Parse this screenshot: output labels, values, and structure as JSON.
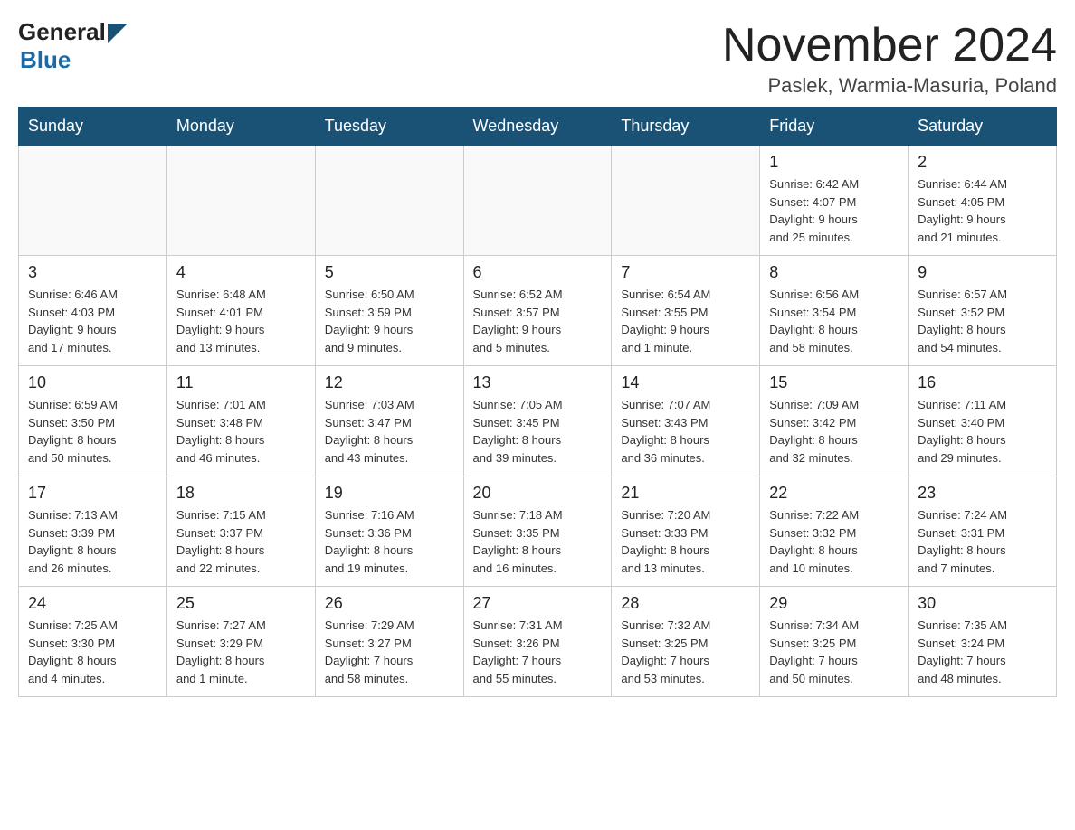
{
  "header": {
    "logo_general": "General",
    "logo_blue": "Blue",
    "month_title": "November 2024",
    "location": "Paslek, Warmia-Masuria, Poland"
  },
  "weekdays": [
    "Sunday",
    "Monday",
    "Tuesday",
    "Wednesday",
    "Thursday",
    "Friday",
    "Saturday"
  ],
  "weeks": [
    [
      {
        "day": "",
        "info": ""
      },
      {
        "day": "",
        "info": ""
      },
      {
        "day": "",
        "info": ""
      },
      {
        "day": "",
        "info": ""
      },
      {
        "day": "",
        "info": ""
      },
      {
        "day": "1",
        "info": "Sunrise: 6:42 AM\nSunset: 4:07 PM\nDaylight: 9 hours\nand 25 minutes."
      },
      {
        "day": "2",
        "info": "Sunrise: 6:44 AM\nSunset: 4:05 PM\nDaylight: 9 hours\nand 21 minutes."
      }
    ],
    [
      {
        "day": "3",
        "info": "Sunrise: 6:46 AM\nSunset: 4:03 PM\nDaylight: 9 hours\nand 17 minutes."
      },
      {
        "day": "4",
        "info": "Sunrise: 6:48 AM\nSunset: 4:01 PM\nDaylight: 9 hours\nand 13 minutes."
      },
      {
        "day": "5",
        "info": "Sunrise: 6:50 AM\nSunset: 3:59 PM\nDaylight: 9 hours\nand 9 minutes."
      },
      {
        "day": "6",
        "info": "Sunrise: 6:52 AM\nSunset: 3:57 PM\nDaylight: 9 hours\nand 5 minutes."
      },
      {
        "day": "7",
        "info": "Sunrise: 6:54 AM\nSunset: 3:55 PM\nDaylight: 9 hours\nand 1 minute."
      },
      {
        "day": "8",
        "info": "Sunrise: 6:56 AM\nSunset: 3:54 PM\nDaylight: 8 hours\nand 58 minutes."
      },
      {
        "day": "9",
        "info": "Sunrise: 6:57 AM\nSunset: 3:52 PM\nDaylight: 8 hours\nand 54 minutes."
      }
    ],
    [
      {
        "day": "10",
        "info": "Sunrise: 6:59 AM\nSunset: 3:50 PM\nDaylight: 8 hours\nand 50 minutes."
      },
      {
        "day": "11",
        "info": "Sunrise: 7:01 AM\nSunset: 3:48 PM\nDaylight: 8 hours\nand 46 minutes."
      },
      {
        "day": "12",
        "info": "Sunrise: 7:03 AM\nSunset: 3:47 PM\nDaylight: 8 hours\nand 43 minutes."
      },
      {
        "day": "13",
        "info": "Sunrise: 7:05 AM\nSunset: 3:45 PM\nDaylight: 8 hours\nand 39 minutes."
      },
      {
        "day": "14",
        "info": "Sunrise: 7:07 AM\nSunset: 3:43 PM\nDaylight: 8 hours\nand 36 minutes."
      },
      {
        "day": "15",
        "info": "Sunrise: 7:09 AM\nSunset: 3:42 PM\nDaylight: 8 hours\nand 32 minutes."
      },
      {
        "day": "16",
        "info": "Sunrise: 7:11 AM\nSunset: 3:40 PM\nDaylight: 8 hours\nand 29 minutes."
      }
    ],
    [
      {
        "day": "17",
        "info": "Sunrise: 7:13 AM\nSunset: 3:39 PM\nDaylight: 8 hours\nand 26 minutes."
      },
      {
        "day": "18",
        "info": "Sunrise: 7:15 AM\nSunset: 3:37 PM\nDaylight: 8 hours\nand 22 minutes."
      },
      {
        "day": "19",
        "info": "Sunrise: 7:16 AM\nSunset: 3:36 PM\nDaylight: 8 hours\nand 19 minutes."
      },
      {
        "day": "20",
        "info": "Sunrise: 7:18 AM\nSunset: 3:35 PM\nDaylight: 8 hours\nand 16 minutes."
      },
      {
        "day": "21",
        "info": "Sunrise: 7:20 AM\nSunset: 3:33 PM\nDaylight: 8 hours\nand 13 minutes."
      },
      {
        "day": "22",
        "info": "Sunrise: 7:22 AM\nSunset: 3:32 PM\nDaylight: 8 hours\nand 10 minutes."
      },
      {
        "day": "23",
        "info": "Sunrise: 7:24 AM\nSunset: 3:31 PM\nDaylight: 8 hours\nand 7 minutes."
      }
    ],
    [
      {
        "day": "24",
        "info": "Sunrise: 7:25 AM\nSunset: 3:30 PM\nDaylight: 8 hours\nand 4 minutes."
      },
      {
        "day": "25",
        "info": "Sunrise: 7:27 AM\nSunset: 3:29 PM\nDaylight: 8 hours\nand 1 minute."
      },
      {
        "day": "26",
        "info": "Sunrise: 7:29 AM\nSunset: 3:27 PM\nDaylight: 7 hours\nand 58 minutes."
      },
      {
        "day": "27",
        "info": "Sunrise: 7:31 AM\nSunset: 3:26 PM\nDaylight: 7 hours\nand 55 minutes."
      },
      {
        "day": "28",
        "info": "Sunrise: 7:32 AM\nSunset: 3:25 PM\nDaylight: 7 hours\nand 53 minutes."
      },
      {
        "day": "29",
        "info": "Sunrise: 7:34 AM\nSunset: 3:25 PM\nDaylight: 7 hours\nand 50 minutes."
      },
      {
        "day": "30",
        "info": "Sunrise: 7:35 AM\nSunset: 3:24 PM\nDaylight: 7 hours\nand 48 minutes."
      }
    ]
  ]
}
